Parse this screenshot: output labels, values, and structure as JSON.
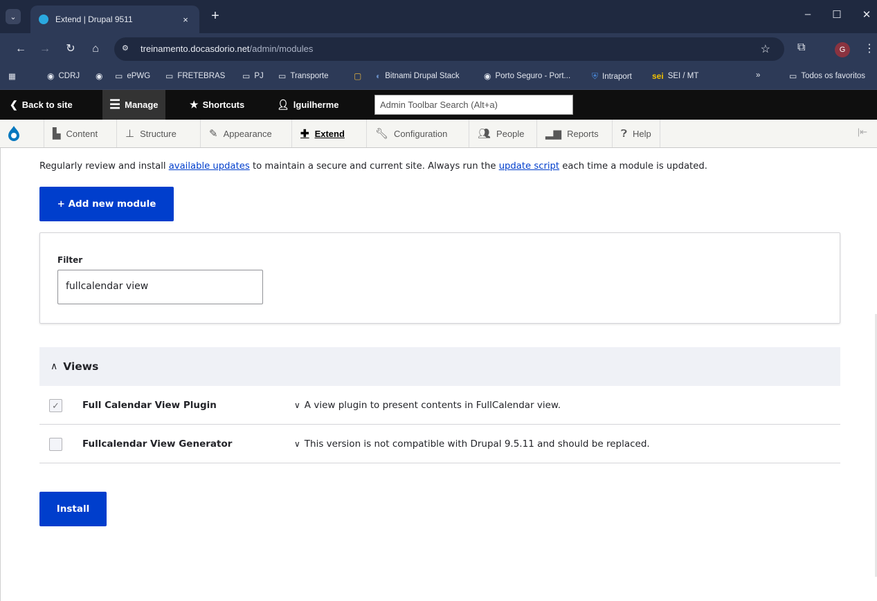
{
  "browser": {
    "tab_title": "Extend | Drupal 9511",
    "tab_close": "×",
    "new_tab": "+",
    "url_host": "treinamento.docasdorio.net",
    "url_path": "/admin/modules",
    "profile_initial": "G",
    "bookmarks": [
      {
        "label": "CDRJ",
        "icon": "globe-icon"
      },
      {
        "label": "",
        "icon": "globe-icon"
      },
      {
        "label": "ePWG",
        "icon": "folder-icon"
      },
      {
        "label": "FRETEBRAS",
        "icon": "folder-icon"
      },
      {
        "label": "PJ",
        "icon": "folder-icon"
      },
      {
        "label": "Transporte",
        "icon": "folder-icon"
      },
      {
        "label": "",
        "icon": "page-icon"
      },
      {
        "label": "Bitnami Drupal Stack",
        "icon": "bitnami-icon"
      },
      {
        "label": "Porto Seguro - Port...",
        "icon": "globe-icon"
      },
      {
        "label": "Intraport",
        "icon": "intraport-icon"
      },
      {
        "label": "SEI / MT",
        "icon": "sei-icon"
      }
    ],
    "bookmarks_overflow": "»",
    "all_bookmarks": "Todos os favoritos",
    "colors": {
      "frame": "#1f2940",
      "toolbar": "#2d3a57"
    }
  },
  "admin_toolbar": {
    "back_to_site": "Back to site",
    "manage": "Manage",
    "shortcuts": "Shortcuts",
    "user": "lguilherme",
    "search_placeholder": "Admin Toolbar Search (Alt+a)"
  },
  "tray": {
    "items": [
      {
        "label": "Content",
        "icon": "file-icon"
      },
      {
        "label": "Structure",
        "icon": "sitemap-icon"
      },
      {
        "label": "Appearance",
        "icon": "brush-icon"
      },
      {
        "label": "Extend",
        "icon": "puzzle-icon",
        "active": true
      },
      {
        "label": "Configuration",
        "icon": "wrench-icon"
      },
      {
        "label": "People",
        "icon": "people-icon"
      },
      {
        "label": "Reports",
        "icon": "bar-chart-icon"
      },
      {
        "label": "Help",
        "icon": "help-icon"
      }
    ]
  },
  "page": {
    "help_prefix": "Regularly review and install ",
    "help_link1": "available updates",
    "help_middle": " to maintain a secure and current site. Always run the ",
    "help_link2": "update script",
    "help_suffix": " each time a module is updated.",
    "add_module_button": "+ Add new module",
    "filter_label": "Filter",
    "filter_value": "fullcalendar view",
    "group_title": "Views",
    "modules": [
      {
        "name": "Full Calendar View Plugin",
        "checked": true,
        "description": "A view plugin to present contents in FullCalendar view."
      },
      {
        "name": "Fullcalendar View Generator",
        "checked": false,
        "description": "This version is not compatible with Drupal 9.5.11 and should be replaced."
      }
    ],
    "install_button": "Install",
    "accent_color": "#003ecc"
  }
}
